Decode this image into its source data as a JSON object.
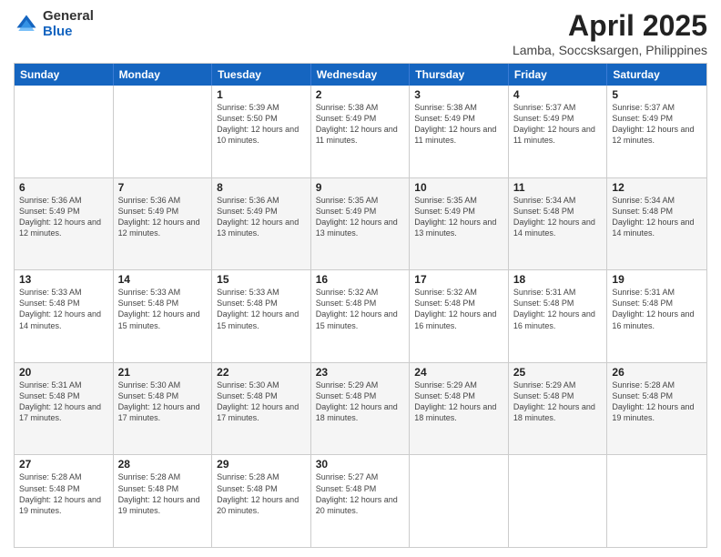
{
  "header": {
    "logo_general": "General",
    "logo_blue": "Blue",
    "title": "April 2025",
    "subtitle": "Lamba, Soccsksargen, Philippines"
  },
  "calendar": {
    "days": [
      "Sunday",
      "Monday",
      "Tuesday",
      "Wednesday",
      "Thursday",
      "Friday",
      "Saturday"
    ],
    "rows": [
      [
        {
          "day": "",
          "info": ""
        },
        {
          "day": "",
          "info": ""
        },
        {
          "day": "1",
          "info": "Sunrise: 5:39 AM\nSunset: 5:50 PM\nDaylight: 12 hours and 10 minutes."
        },
        {
          "day": "2",
          "info": "Sunrise: 5:38 AM\nSunset: 5:49 PM\nDaylight: 12 hours and 11 minutes."
        },
        {
          "day": "3",
          "info": "Sunrise: 5:38 AM\nSunset: 5:49 PM\nDaylight: 12 hours and 11 minutes."
        },
        {
          "day": "4",
          "info": "Sunrise: 5:37 AM\nSunset: 5:49 PM\nDaylight: 12 hours and 11 minutes."
        },
        {
          "day": "5",
          "info": "Sunrise: 5:37 AM\nSunset: 5:49 PM\nDaylight: 12 hours and 12 minutes."
        }
      ],
      [
        {
          "day": "6",
          "info": "Sunrise: 5:36 AM\nSunset: 5:49 PM\nDaylight: 12 hours and 12 minutes."
        },
        {
          "day": "7",
          "info": "Sunrise: 5:36 AM\nSunset: 5:49 PM\nDaylight: 12 hours and 12 minutes."
        },
        {
          "day": "8",
          "info": "Sunrise: 5:36 AM\nSunset: 5:49 PM\nDaylight: 12 hours and 13 minutes."
        },
        {
          "day": "9",
          "info": "Sunrise: 5:35 AM\nSunset: 5:49 PM\nDaylight: 12 hours and 13 minutes."
        },
        {
          "day": "10",
          "info": "Sunrise: 5:35 AM\nSunset: 5:49 PM\nDaylight: 12 hours and 13 minutes."
        },
        {
          "day": "11",
          "info": "Sunrise: 5:34 AM\nSunset: 5:48 PM\nDaylight: 12 hours and 14 minutes."
        },
        {
          "day": "12",
          "info": "Sunrise: 5:34 AM\nSunset: 5:48 PM\nDaylight: 12 hours and 14 minutes."
        }
      ],
      [
        {
          "day": "13",
          "info": "Sunrise: 5:33 AM\nSunset: 5:48 PM\nDaylight: 12 hours and 14 minutes."
        },
        {
          "day": "14",
          "info": "Sunrise: 5:33 AM\nSunset: 5:48 PM\nDaylight: 12 hours and 15 minutes."
        },
        {
          "day": "15",
          "info": "Sunrise: 5:33 AM\nSunset: 5:48 PM\nDaylight: 12 hours and 15 minutes."
        },
        {
          "day": "16",
          "info": "Sunrise: 5:32 AM\nSunset: 5:48 PM\nDaylight: 12 hours and 15 minutes."
        },
        {
          "day": "17",
          "info": "Sunrise: 5:32 AM\nSunset: 5:48 PM\nDaylight: 12 hours and 16 minutes."
        },
        {
          "day": "18",
          "info": "Sunrise: 5:31 AM\nSunset: 5:48 PM\nDaylight: 12 hours and 16 minutes."
        },
        {
          "day": "19",
          "info": "Sunrise: 5:31 AM\nSunset: 5:48 PM\nDaylight: 12 hours and 16 minutes."
        }
      ],
      [
        {
          "day": "20",
          "info": "Sunrise: 5:31 AM\nSunset: 5:48 PM\nDaylight: 12 hours and 17 minutes."
        },
        {
          "day": "21",
          "info": "Sunrise: 5:30 AM\nSunset: 5:48 PM\nDaylight: 12 hours and 17 minutes."
        },
        {
          "day": "22",
          "info": "Sunrise: 5:30 AM\nSunset: 5:48 PM\nDaylight: 12 hours and 17 minutes."
        },
        {
          "day": "23",
          "info": "Sunrise: 5:29 AM\nSunset: 5:48 PM\nDaylight: 12 hours and 18 minutes."
        },
        {
          "day": "24",
          "info": "Sunrise: 5:29 AM\nSunset: 5:48 PM\nDaylight: 12 hours and 18 minutes."
        },
        {
          "day": "25",
          "info": "Sunrise: 5:29 AM\nSunset: 5:48 PM\nDaylight: 12 hours and 18 minutes."
        },
        {
          "day": "26",
          "info": "Sunrise: 5:28 AM\nSunset: 5:48 PM\nDaylight: 12 hours and 19 minutes."
        }
      ],
      [
        {
          "day": "27",
          "info": "Sunrise: 5:28 AM\nSunset: 5:48 PM\nDaylight: 12 hours and 19 minutes."
        },
        {
          "day": "28",
          "info": "Sunrise: 5:28 AM\nSunset: 5:48 PM\nDaylight: 12 hours and 19 minutes."
        },
        {
          "day": "29",
          "info": "Sunrise: 5:28 AM\nSunset: 5:48 PM\nDaylight: 12 hours and 20 minutes."
        },
        {
          "day": "30",
          "info": "Sunrise: 5:27 AM\nSunset: 5:48 PM\nDaylight: 12 hours and 20 minutes."
        },
        {
          "day": "",
          "info": ""
        },
        {
          "day": "",
          "info": ""
        },
        {
          "day": "",
          "info": ""
        }
      ]
    ]
  }
}
